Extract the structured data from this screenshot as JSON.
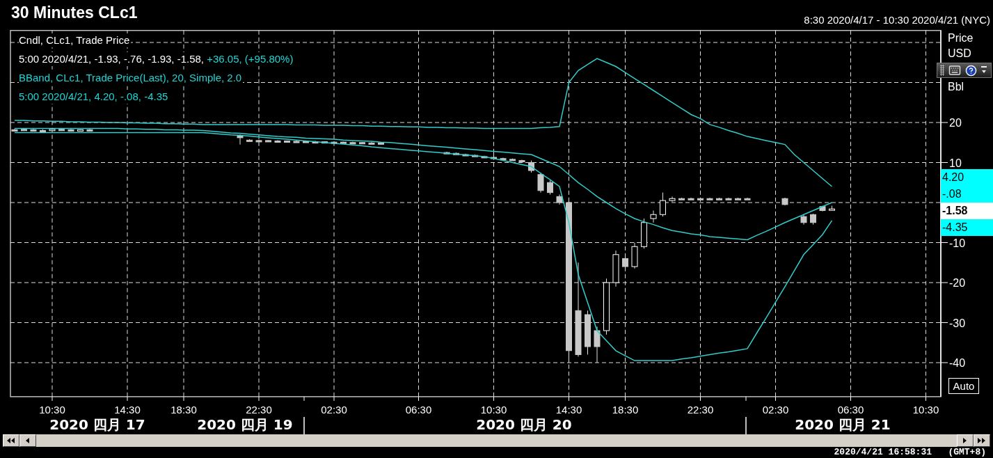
{
  "header": {
    "title": "30 Minutes CLc1",
    "range": "8:30 2020/4/17 - 10:30 2020/4/21 (NYC)"
  },
  "legend": [
    {
      "kind": "candle",
      "text": "Cndl, CLc1, Trade Price"
    },
    {
      "kind": "candle",
      "text": "5:00 2020/4/21, -1.93, -.76, -1.93, -1.58,",
      "change": "+36.05, (+95.80%)"
    },
    {
      "kind": "band",
      "text": "BBand, CLc1, Trade Price(Last),  20, Simple, 2.0"
    },
    {
      "kind": "band",
      "text": "5:00 2020/4/21, 4.20, -.08, -4.35"
    }
  ],
  "axis_units": [
    "Price",
    "USD",
    "Bbl"
  ],
  "value_badges": [
    {
      "kind": "band",
      "text": "4.20",
      "color": "#00ffff"
    },
    {
      "kind": "band",
      "text": "-.08",
      "color": "#00ffff"
    },
    {
      "kind": "price",
      "text": "-1.58",
      "color": "#ffffff"
    },
    {
      "kind": "band",
      "text": "-4.35",
      "color": "#00ffff"
    }
  ],
  "auto_button": "Auto",
  "chart_data": {
    "type": "candlestick",
    "grid": true,
    "ylim": [
      -48.5,
      43
    ],
    "yticks": [
      20,
      10,
      -10,
      -20,
      -30,
      -40
    ],
    "categories": [
      null,
      null,
      null,
      null,
      "10:30",
      null,
      null,
      null,
      null,
      null,
      null,
      null,
      "14:30",
      null,
      null,
      null,
      null,
      null,
      "18:30",
      null,
      null,
      null,
      null,
      null,
      null,
      null,
      "22:30",
      null,
      null,
      null,
      null,
      null,
      null,
      null,
      "02:30",
      null,
      null,
      null,
      null,
      null,
      null,
      null,
      null,
      "06:30",
      null,
      null,
      null,
      null,
      null,
      null,
      null,
      "10:30",
      null,
      null,
      null,
      null,
      null,
      null,
      null,
      "14:30",
      null,
      null,
      null,
      null,
      null,
      "18:30",
      null,
      null,
      null,
      null,
      null,
      null,
      null,
      "22:30",
      null,
      null,
      null,
      null,
      null,
      null,
      null,
      "02:30",
      null,
      null,
      null,
      null,
      null,
      null,
      null,
      "06:30",
      null,
      null,
      null,
      null,
      null,
      null,
      null,
      "10:30",
      null
    ],
    "ohlc": [
      [
        18.2,
        18.4,
        18,
        18.2
      ],
      [
        18.3,
        18.5,
        18,
        18.1
      ],
      [
        18.2,
        18.4,
        18,
        18.2
      ],
      [
        18,
        18.3,
        17.8,
        18
      ],
      [
        18.2,
        18.4,
        18,
        18.3
      ],
      [
        18.3,
        18.5,
        18.1,
        18.2
      ],
      [
        18.2,
        18.4,
        18,
        18.2
      ],
      [
        18.1,
        18.3,
        17.9,
        18.2
      ],
      [
        18.2,
        18.4,
        18,
        18.1
      ],
      null,
      null,
      null,
      null,
      null,
      null,
      null,
      null,
      null,
      null,
      null,
      null,
      null,
      null,
      null,
      [
        16.8,
        17,
        14.5,
        16.2
      ],
      [
        15.6,
        15.8,
        15.4,
        15.5
      ],
      [
        15.5,
        15.7,
        15.3,
        15.5
      ],
      [
        15.5,
        15.6,
        15.3,
        15.4
      ],
      [
        15.4,
        15.6,
        15.2,
        15.4
      ],
      [
        15.4,
        15.5,
        15.2,
        15.3
      ],
      [
        15.3,
        15.5,
        15.1,
        15.3
      ],
      [
        15.3,
        15.4,
        15.1,
        15.2
      ],
      [
        15.2,
        15.4,
        15,
        15.2
      ],
      [
        15.2,
        15.3,
        15,
        15.1
      ],
      [
        15.1,
        15.3,
        14.9,
        15.1
      ],
      [
        15.1,
        15.2,
        14.9,
        15
      ],
      [
        15,
        15.2,
        14.8,
        15
      ],
      [
        15,
        15.1,
        14.8,
        14.9
      ],
      [
        14.9,
        15.1,
        14.7,
        14.9
      ],
      [
        14.9,
        15,
        14.7,
        14.8
      ],
      null,
      null,
      null,
      null,
      null,
      null,
      [
        12.5,
        12.7,
        12.3,
        12.5
      ],
      [
        12.3,
        12.5,
        12.1,
        12.3
      ],
      [
        12,
        12.2,
        11.8,
        12
      ],
      [
        11.8,
        12,
        11.6,
        11.8
      ],
      [
        11.5,
        11.7,
        11.3,
        11.5
      ],
      [
        11.3,
        12.5,
        11.1,
        11.3
      ],
      [
        11,
        11.2,
        10.8,
        11
      ],
      [
        10.8,
        11,
        10.6,
        10.8
      ],
      [
        10.5,
        10.7,
        10.3,
        10.5
      ],
      [
        10,
        10.5,
        7.5,
        8
      ],
      [
        7,
        7.5,
        2.5,
        3
      ],
      [
        5,
        5.5,
        2,
        2.5
      ],
      [
        1.5,
        2,
        -0.5,
        0
      ],
      [
        0,
        0.5,
        -40,
        -37
      ],
      [
        -27,
        -15,
        -38.5,
        -38
      ],
      [
        -28,
        -27,
        -38,
        -36
      ],
      [
        -32,
        -31,
        -40,
        -36
      ],
      [
        -32,
        -19,
        -33,
        -20
      ],
      [
        -20,
        -12,
        -21,
        -13
      ],
      [
        -14,
        -13,
        -16.5,
        -16
      ],
      [
        -16,
        -10,
        -16.5,
        -11
      ],
      [
        -11,
        -4,
        -11.5,
        -5
      ],
      [
        -4,
        -2,
        -5,
        -3
      ],
      [
        -3,
        2.5,
        -3.5,
        0.5
      ],
      [
        0.5,
        1.5,
        0.2,
        1
      ],
      [
        1,
        1.2,
        0.8,
        1
      ],
      [
        1,
        1.2,
        0.8,
        1
      ],
      [
        1,
        1.2,
        0.8,
        1
      ],
      [
        1,
        1.2,
        0.8,
        1
      ],
      [
        1,
        1.2,
        0.8,
        1
      ],
      [
        1,
        1.2,
        0.8,
        1
      ],
      [
        1,
        1.2,
        0.8,
        1
      ],
      [
        1,
        1.2,
        0.8,
        1
      ],
      null,
      null,
      null,
      [
        1,
        1.2,
        -0.7,
        -0.5
      ],
      null,
      [
        -3.5,
        -3,
        -5.5,
        -5
      ],
      [
        -3,
        -2.8,
        -5.5,
        -5
      ],
      [
        -1,
        -0.8,
        -2.2,
        -2
      ],
      [
        -1.9,
        -0.8,
        -1.9,
        -1.6
      ],
      null,
      null,
      null,
      null,
      null,
      null,
      null,
      null,
      null,
      null,
      null
    ],
    "series": [
      {
        "type": "line",
        "color": "#33cccc",
        "values": [
          20.5,
          20.5,
          20.4,
          20.4,
          20.3,
          20.3,
          20.2,
          20.2,
          20.1,
          20.1,
          20,
          20,
          19.9,
          19.9,
          19.8,
          19.8,
          19.7,
          19.7,
          19.6,
          19.6,
          19.5,
          19.5,
          19.5,
          19.5,
          19.5,
          19.5,
          19.5,
          19.5,
          19.5,
          19.5,
          19.4,
          19.4,
          19.4,
          19.3,
          19.3,
          19.3,
          19.2,
          19.2,
          19.1,
          19.1,
          19,
          19,
          18.9,
          18.9,
          18.8,
          18.8,
          18.7,
          18.7,
          18.6,
          18.6,
          18.5,
          18.5,
          18.5,
          18.5,
          18.5,
          18.5,
          18.7,
          18.8,
          19,
          30,
          33,
          34.5,
          36,
          35,
          34,
          32.5,
          31,
          29.5,
          28,
          26.5,
          25,
          23.5,
          22,
          21,
          19.5,
          18.8,
          18,
          17.3,
          16.5,
          16,
          15.5,
          15,
          14.5,
          12,
          10,
          8,
          6,
          4,
          null,
          null,
          null,
          null,
          null,
          null,
          null,
          null,
          null,
          null,
          null
        ]
      },
      {
        "type": "line",
        "color": "#33cccc",
        "values": [
          18.5,
          18.5,
          18.5,
          18.5,
          18.5,
          18.5,
          18.5,
          18.5,
          18.5,
          18.5,
          18.5,
          18.5,
          18.4,
          18.4,
          18.3,
          18.3,
          18.2,
          18.2,
          18.1,
          18.1,
          18,
          17.8,
          17.6,
          17.4,
          17.3,
          17.1,
          16.9,
          16.7,
          16.5,
          16.4,
          16.3,
          16.1,
          16,
          15.9,
          15.8,
          15.6,
          15.5,
          15.4,
          15.3,
          15.1,
          15,
          14.8,
          14.6,
          14.4,
          14.2,
          14,
          13.8,
          13.6,
          13.4,
          13.2,
          13,
          12.8,
          12.6,
          12.4,
          12.2,
          12,
          11,
          10,
          9,
          7,
          5,
          3.3,
          1.5,
          0,
          -1.5,
          -2.8,
          -4,
          -4.8,
          -5.5,
          -6.3,
          -7,
          -7.4,
          -7.8,
          -8.1,
          -8.5,
          -8.7,
          -8.9,
          -9.1,
          -9.3,
          -8.2,
          -7.2,
          -6.1,
          -5,
          -4,
          -3,
          -2,
          -1,
          0,
          null,
          null,
          null,
          null,
          null,
          null,
          null,
          null,
          null,
          null,
          null
        ]
      },
      {
        "type": "line",
        "color": "#33cccc",
        "values": [
          17.5,
          17.5,
          17.5,
          17.5,
          17.5,
          17.5,
          17.5,
          17.5,
          17.5,
          17.5,
          17.5,
          17.5,
          17.5,
          17.5,
          17.5,
          17.5,
          17.5,
          17.5,
          17.5,
          17.5,
          17.5,
          17.3,
          17.1,
          16.9,
          16.8,
          16.6,
          16.4,
          16.2,
          16,
          15.8,
          15.6,
          15.4,
          15.2,
          15,
          14.8,
          14.6,
          14.4,
          14.2,
          13.9,
          13.7,
          13.5,
          13.3,
          13.1,
          12.9,
          12.7,
          12.5,
          12.3,
          12.1,
          11.9,
          11.7,
          11.5,
          11,
          10.5,
          10,
          9.5,
          9,
          7.3,
          5.7,
          4,
          -5,
          -18,
          -25,
          -32,
          -34.5,
          -37,
          -38.3,
          -39.5,
          -39.5,
          -39.5,
          -39.5,
          -39.5,
          -39.1,
          -38.8,
          -38.4,
          -38,
          -37.6,
          -37.3,
          -36.9,
          -36.5,
          -32.6,
          -28.8,
          -24.9,
          -21,
          -17,
          -13,
          -10.5,
          -8,
          -4.5,
          null,
          null,
          null,
          null,
          null,
          null,
          null,
          null,
          null,
          null,
          null
        ]
      }
    ]
  },
  "date_labels": [
    "2020 四月 17",
    "2020 四月 19",
    "2020 四月 20",
    "2020 四月 21"
  ],
  "status_clock": "2020/4/21 16:58:31   (GMT+8)"
}
